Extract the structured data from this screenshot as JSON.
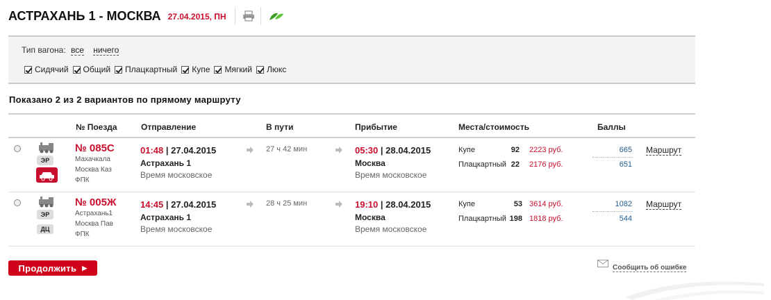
{
  "header": {
    "title": "АСТРАХАНЬ 1 - МОСКВА",
    "date": "27.04.2015, ПН"
  },
  "filter": {
    "label": "Тип вагона:",
    "all": "все",
    "none": "ничего",
    "types": [
      "Сидячий",
      "Общий",
      "Плацкартный",
      "Купе",
      "Мягкий",
      "Люкс"
    ]
  },
  "summary": "Показано 2 из 2 вариантов по прямому маршруту",
  "columns": {
    "train": "№ Поезда",
    "departure": "Отправление",
    "duration": "В пути",
    "arrival": "Прибытие",
    "seats": "Места/стоимость",
    "points": "Баллы"
  },
  "trains": [
    {
      "number": "№ 085С",
      "tag1": "ЭР",
      "from": "Махачкала",
      "to": "Москва Каз",
      "carrier": "ФПК",
      "dep_time": "01:48",
      "dep_date": "| 27.04.2015",
      "dep_station": "Астрахань 1",
      "dep_tz": "Время московское",
      "duration": "27 ч 42 мин",
      "arr_time": "05:30",
      "arr_date": "| 28.04.2015",
      "arr_station": "Москва",
      "arr_tz": "Время московское",
      "seat1_type": "Купе",
      "seat1_count": "92",
      "seat1_price": "2223 руб.",
      "seat1_points": "665",
      "seat2_type": "Плацкартный",
      "seat2_count": "22",
      "seat2_price": "2176 руб.",
      "seat2_points": "651",
      "route": "Маршрут"
    },
    {
      "number": "№ 005Ж",
      "tag1": "ЭР",
      "tag2": "ДЦ",
      "from": "Астрахань1",
      "to": "Москва Пав",
      "carrier": "ФПК",
      "dep_time": "14:45",
      "dep_date": "| 27.04.2015",
      "dep_station": "Астрахань 1",
      "dep_tz": "Время московское",
      "duration": "28 ч 25 мин",
      "arr_time": "19:10",
      "arr_date": "| 28.04.2015",
      "arr_station": "Москва",
      "arr_tz": "Время московское",
      "seat1_type": "Купе",
      "seat1_count": "53",
      "seat1_price": "3614 руб.",
      "seat1_points": "1082",
      "seat2_type": "Плацкартный",
      "seat2_count": "198",
      "seat2_price": "1818 руб.",
      "seat2_points": "544",
      "route": "Маршрут"
    }
  ],
  "continue_button": "Продолжить",
  "report_link": "Сообщить об ошибке",
  "colors": {
    "accent": "#c8102e",
    "button": "#d0021b",
    "points": "#1f5b8f"
  }
}
